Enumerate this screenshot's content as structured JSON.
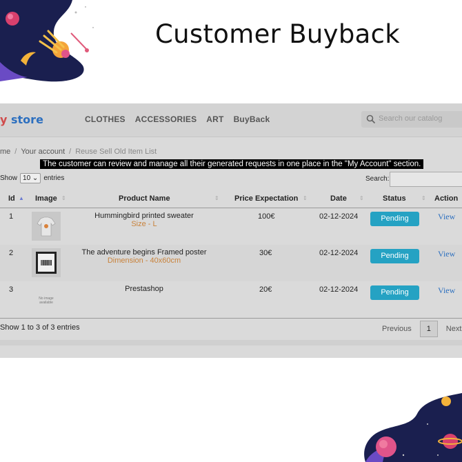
{
  "slide": {
    "title": "Customer Buyback"
  },
  "store": {
    "logo_prefix": "y",
    "logo_rest": " store",
    "menu": [
      "CLOTHES",
      "ACCESSORIES",
      "ART",
      "BuyBack"
    ],
    "search_placeholder": "Search our catalog"
  },
  "breadcrumb": {
    "home": "me",
    "account": "Your account",
    "current": "Reuse Sell Old Item List"
  },
  "tooltip": "The customer can review and manage all their generated requests in one place in the \"My Account\" section.",
  "table_controls": {
    "show": "Show",
    "page_size": "10",
    "entries": "entries",
    "search_label": "Search:"
  },
  "table": {
    "headers": [
      "Id",
      "Image",
      "Product Name",
      "Price Expectation",
      "Date",
      "Status",
      "Action"
    ],
    "rows": [
      {
        "id": "1",
        "name": "Hummingbird printed sweater",
        "attr": "Size - L",
        "price": "100€",
        "date": "02-12-2024",
        "status": "Pending",
        "action": "View",
        "image": "sweater-image"
      },
      {
        "id": "2",
        "name": "The adventure begins Framed poster",
        "attr": "Dimension - 40x60cm",
        "price": "30€",
        "date": "02-12-2024",
        "status": "Pending",
        "action": "View",
        "image": "poster-image"
      },
      {
        "id": "3",
        "name": "Prestashop",
        "attr": "",
        "price": "20€",
        "date": "02-12-2024",
        "status": "Pending",
        "action": "View",
        "image": "no-image",
        "no_image_text": "No image available"
      }
    ]
  },
  "footer": {
    "info": "Show 1 to 3 of 3 entries",
    "previous": "Previous",
    "page": "1",
    "next": "Next"
  },
  "colors": {
    "status_bg": "#25a2c3",
    "link": "#2c6fbf",
    "attr": "#c8823b"
  }
}
